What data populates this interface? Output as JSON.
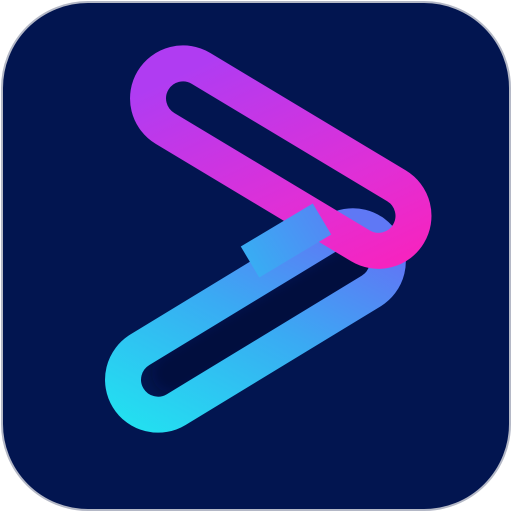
{
  "icon": {
    "name": "play-link-logo",
    "colors": {
      "background": "#021550",
      "border": "#b4b8c6",
      "outer_page": "#ffffff",
      "upper_link_gradient": [
        "#b03cf2",
        "#e02fd6",
        "#ff1fb6"
      ],
      "lower_link_gradient": [
        "#1fe8f0",
        "#3aaaf3",
        "#5f78f5"
      ]
    }
  }
}
